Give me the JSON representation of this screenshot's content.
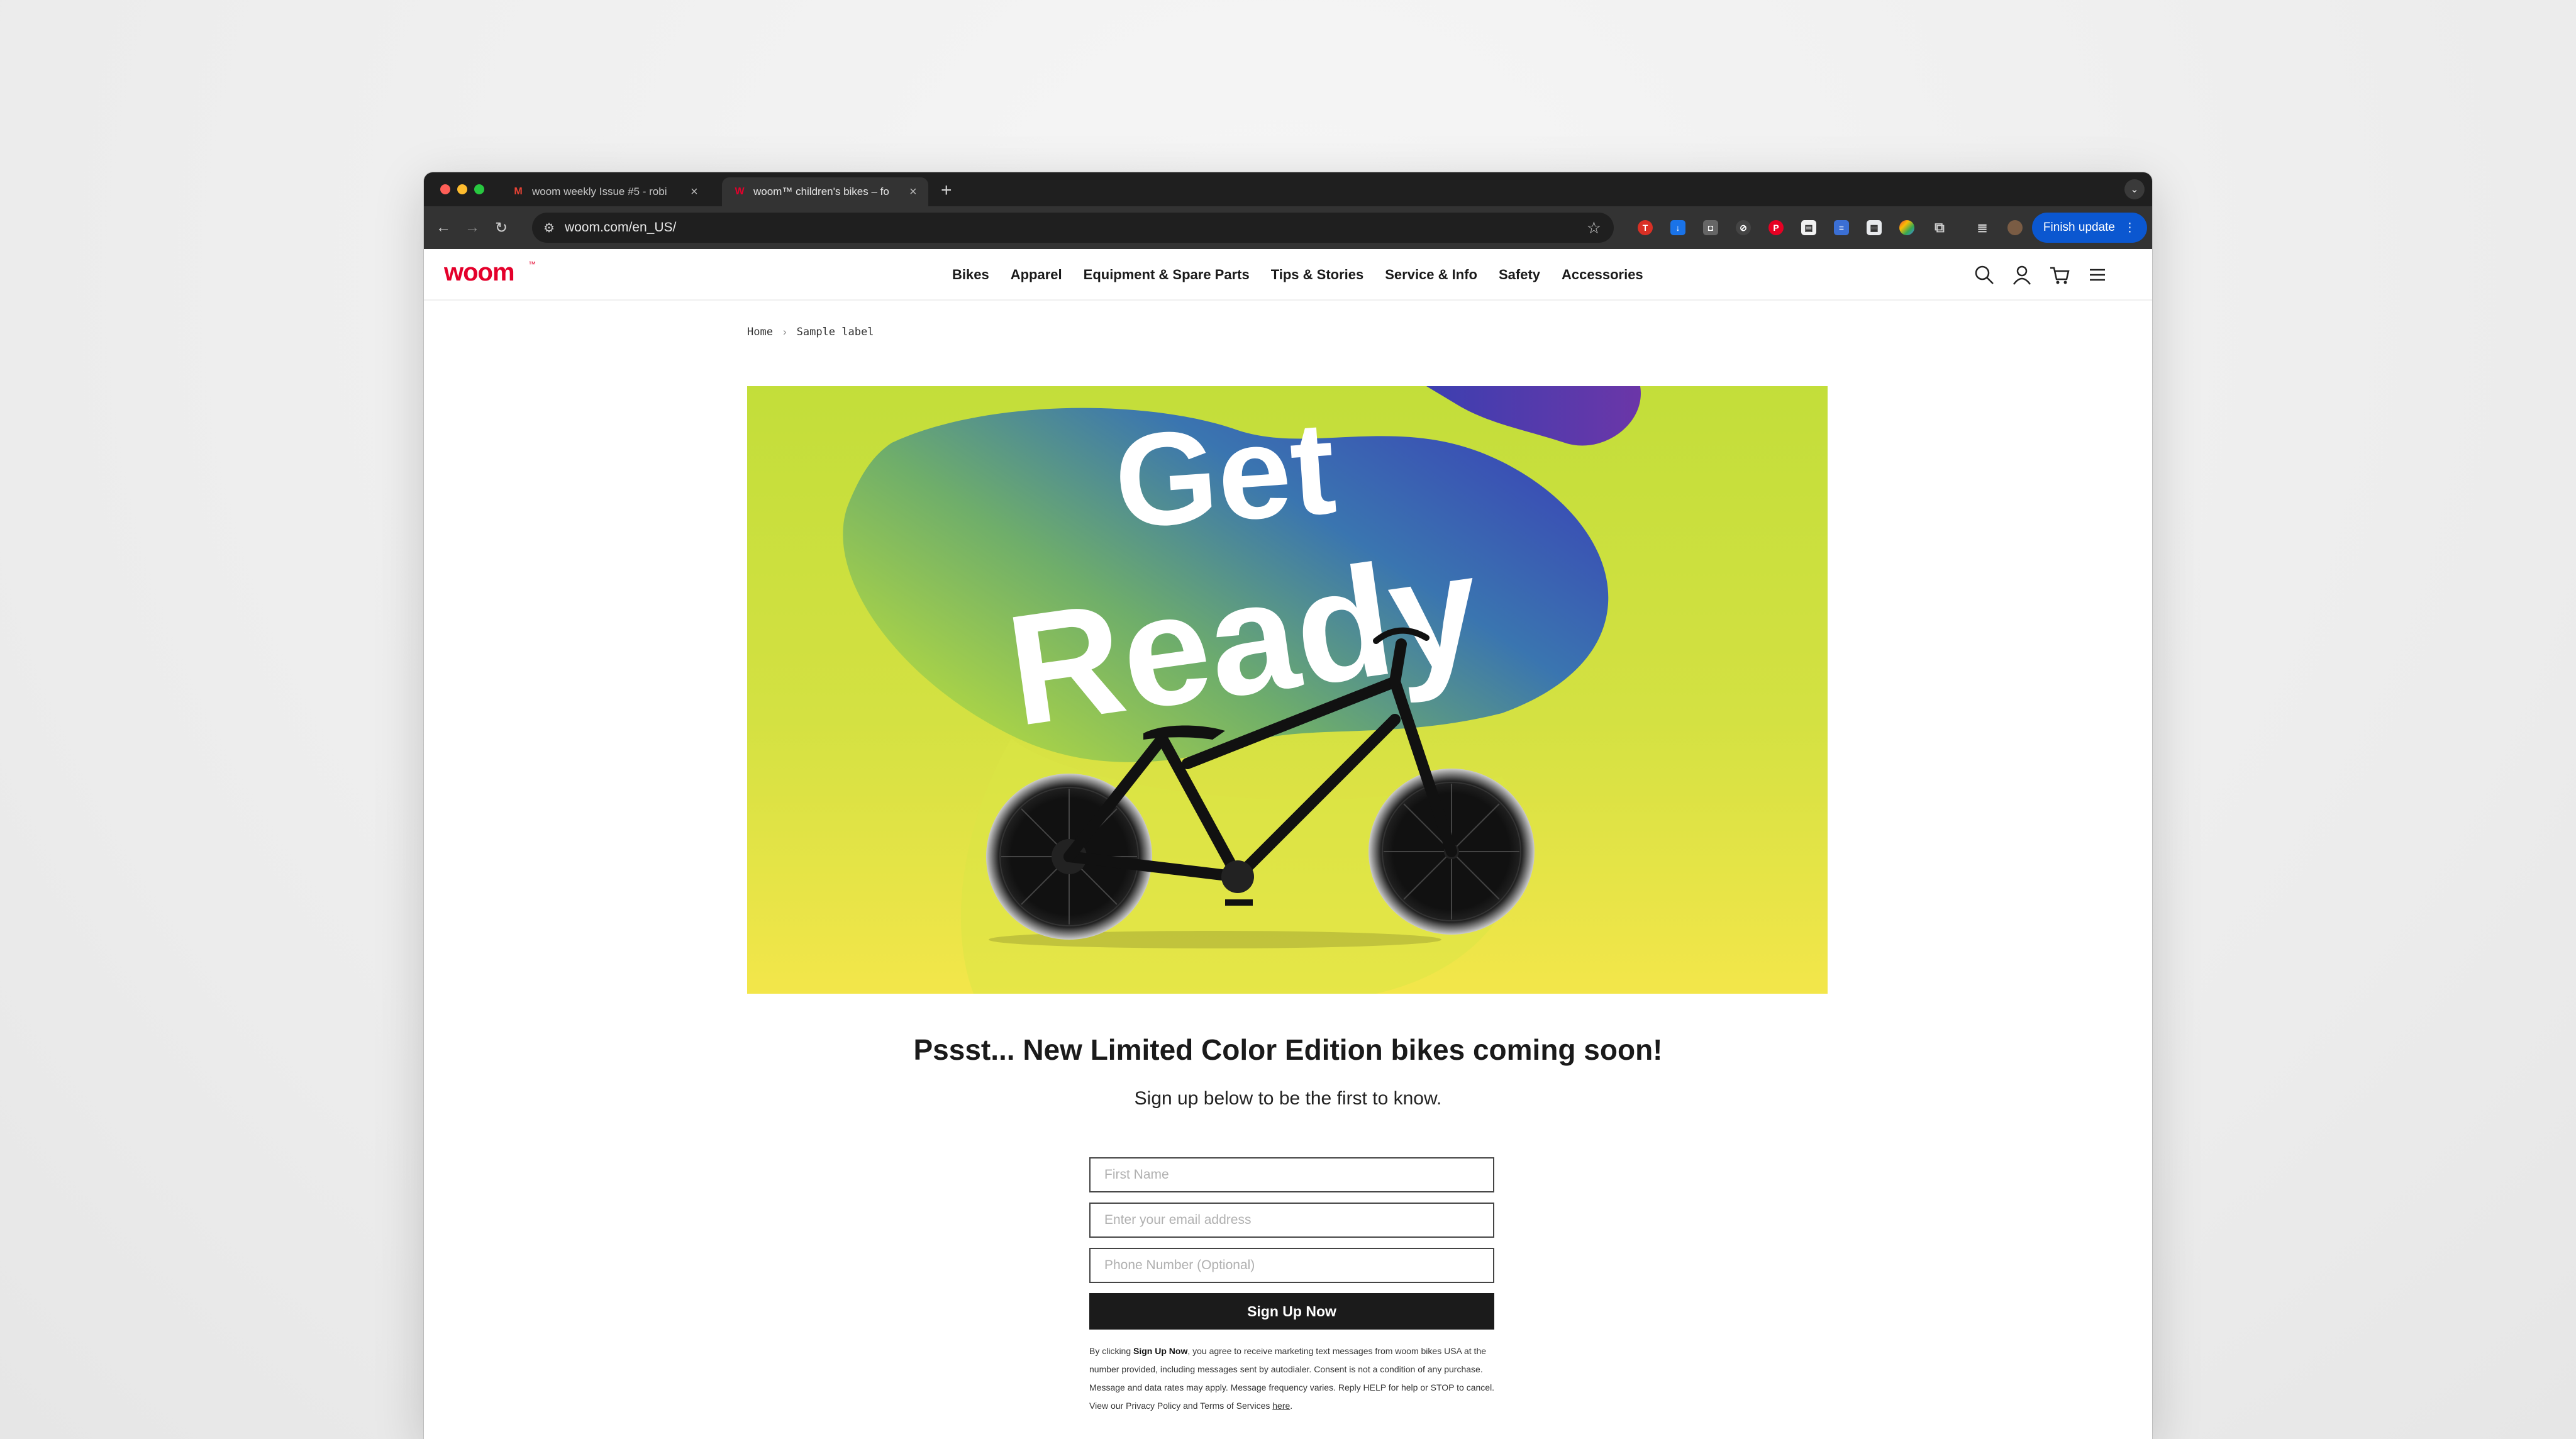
{
  "browser": {
    "tabs": [
      {
        "title": "woom weekly Issue #5 - robi",
        "favicon": "gmail-icon"
      },
      {
        "title": "woom™ children's bikes – fo",
        "favicon": "woom-icon",
        "active": true
      }
    ],
    "url": "woom.com/en_US/",
    "finish_update_label": "Finish update"
  },
  "site": {
    "nav": [
      "Bikes",
      "Apparel",
      "Equipment & Spare Parts",
      "Tips & Stories",
      "Service & Info",
      "Safety",
      "Accessories"
    ],
    "breadcrumb": {
      "home": "Home",
      "current": "Sample label"
    }
  },
  "hero": {
    "line1": "Get",
    "line2": "Ready",
    "colors": {
      "lime": "#c3de3a",
      "yellow": "#f3e64a",
      "blue": "#2f5fb8",
      "purple": "#6a3aa8"
    }
  },
  "signup": {
    "headline": "Pssst... New Limited Color Edition bikes coming soon!",
    "subhead": "Sign up below to be the first to know.",
    "first_name_placeholder": "First Name",
    "email_placeholder": "Enter your email address",
    "phone_placeholder": "Phone Number (Optional)",
    "button_label": "Sign Up Now",
    "legal": {
      "prefix": "By clicking ",
      "bold": "Sign Up Now",
      "body": ", you agree to receive marketing text messages from woom bikes USA at the number provided, including messages sent by autodialer. Consent is not a condition of any purchase. Message and data rates may apply. Message frequency varies. Reply HELP for help or STOP to cancel. View our Privacy Policy and Terms of Services ",
      "link": "here",
      "end": "."
    }
  }
}
